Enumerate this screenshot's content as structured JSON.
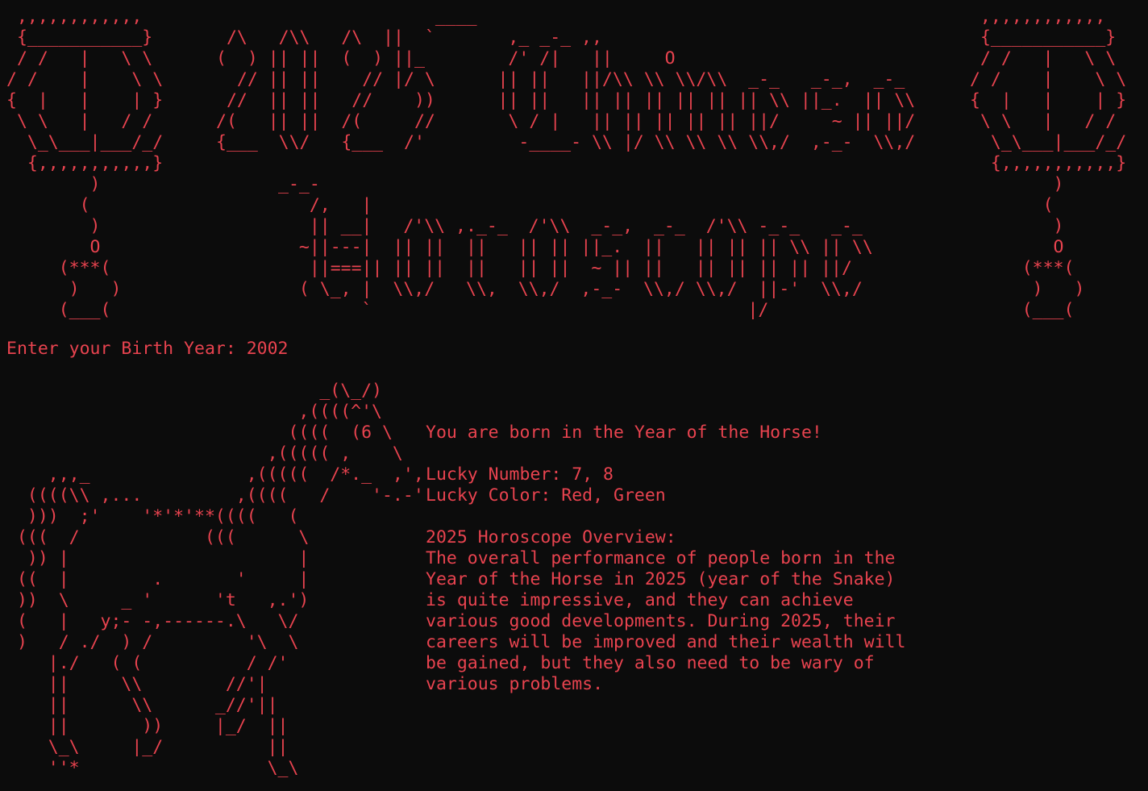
{
  "theme": {
    "background": "#0c0c0c",
    "foreground": "#e8434f"
  },
  "banner": {
    "lantern_left": " ,,,,,,,,,,,,\n {___________}\n / /   |   \\ \\\n/ /    |    \\ \\\n{  |   |    | }\n \\ \\   |   / /\n  \\_\\___|___/_/\n  {,,,,,,,,,,,}\n        )\n       (\n        )\n        O\n     (***(\n      )   )\n     (___(",
    "title": "                     ____\n /\\   /\\\\   /\\  ||  `       ,_ _-_ ,,\n(  ) || ||  (  ) ||_        /' /|   ||     O\n  // || ||    // |/ \\      || ||   ||/\\\\ \\\\ \\\\/\\\\  _-_   _-_,  _-_\n //  || ||   //    ))      || ||   || || || || || || \\\\ ||_.  || \\\\\n/(   || ||  /(     //       \\ / |   || || || || || ||/     ~ || ||/\n{___  \\\\/   {___  /'         -____- \\\\ |/ \\\\ \\\\ \\\\ \\\\,/  ,-_-  \\\\,/",
    "lantern_right": " ,,,,,,,,,,,,\n {___________}\n / /   |   \\ \\\n/ /    |    \\ \\\n{  |   |    | }\n \\ \\   |   / /\n  \\_\\___|___/_/\n  {,,,,,,,,,,,}\n        )\n       (\n        )\n        O\n     (***(\n      )   )\n     (___(",
    "subtitle": "_-_-\n   /,   |\n   || __|   /'\\\\ ,._-_  /'\\\\  _-_,  _-_  /'\\\\ -_-_   _-_\n  ~||---|  || ||  ||   || || ||_.  ||   || || || \\\\ || \\\\\n   ||===|| || ||  ||   || ||  ~ || ||   || || || || ||/\n  ( \\_, |  \\\\,/   \\\\,  \\\\,/  ,-_-  \\\\,/ \\\\,/  ||-'  \\\\,/\n        `                                    |/"
  },
  "prompt": {
    "label": "Enter your Birth Year: ",
    "value": "2002"
  },
  "horse_art": "                              _(\\_/)\n                            ,((((^'\\\n                           ((((  (6 \\\n                         ,((((( ,    \\\n    ,,,_               ,(((((  /*._  ,',\n  ((((\\\\ ,...         ,((((   /    '-.-'\n  )))  ;'    '*'*'**((((   (\n (((  /            (((      \\\n  )) |                      |\n ((  |        .       '     |\n ))  \\     _ '      't   ,.')\n (   |   y;- -,------.\\   \\/\n )   / ./  ) /         '\\  \\\n    |./   ( (          / /'\n    ||     \\\\        //'|\n    ||      \\\\      _//'||\n    ||       ))     |_/  ||\n    \\_\\     |_/          ||\n    ''*                  \\_\\",
  "result": {
    "headline": "You are born in the Year of the Horse!",
    "lucky_number_label": "Lucky Number: ",
    "lucky_number": "7, 8",
    "lucky_color_label": "Lucky Color: ",
    "lucky_color": "Red, Green",
    "overview_title": "2025 Horoscope Overview:",
    "overview_lines": [
      "The overall performance of people born in the",
      "Year of the Horse in 2025 (year of the Snake)",
      "is quite impressive, and they can achieve",
      "various good developments. During 2025, their",
      "careers will be improved and their wealth will",
      "be gained, but they also need to be wary of",
      "various problems."
    ]
  }
}
